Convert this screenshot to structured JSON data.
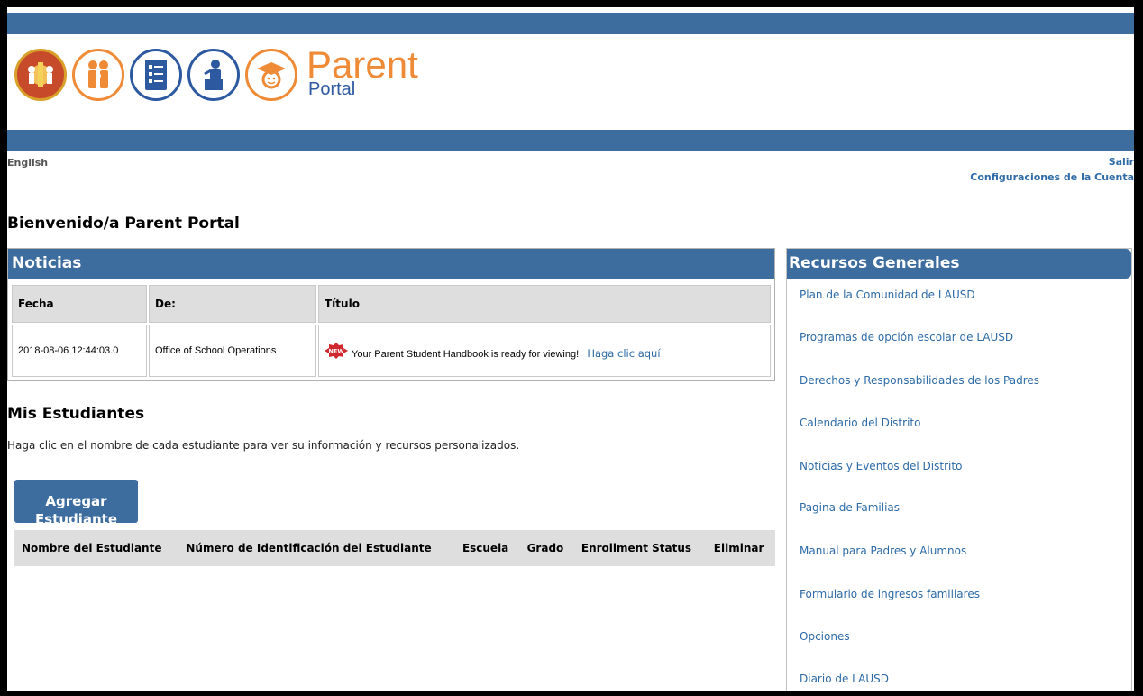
{
  "brand": {
    "parent": "Parent",
    "portal": "Portal",
    "colors": {
      "header_bar": "#3d6c9e",
      "orange": "#ef8a36",
      "blue": "#2c59a0",
      "link": "#2d6aa6"
    }
  },
  "header": {
    "language": "English",
    "logout": "Salir",
    "account_settings": "Configuraciones de la Cuenta"
  },
  "welcome": "Bienvenido/a Parent Portal",
  "news": {
    "title": "Noticias",
    "columns": [
      "Fecha",
      "De:",
      "Título"
    ],
    "rows": [
      {
        "date": "2018-08-06 12:44:03.0",
        "from": "Office of School Operations",
        "badge": "NEW",
        "text": "Your Parent Student Handbook is ready for viewing!",
        "link": "Haga clic aquí"
      }
    ]
  },
  "students": {
    "title": "Mis Estudiantes",
    "description": "Haga clic en el nombre de cada estudiante para ver su información y recursos personalizados.",
    "add_button": "Agregar Estudiante",
    "columns": [
      "Nombre del Estudiante",
      "Número de Identificación del Estudiante",
      "Escuela",
      "Grado",
      "Enrollment Status",
      "Eliminar"
    ]
  },
  "resources": {
    "title": "Recursos Generales",
    "items": [
      "Plan de la Comunidad de LAUSD",
      "Programas de opción escolar de LAUSD",
      "Derechos y Responsabilidades de los Padres",
      "Calendario del Distrito",
      "Noticias y Eventos del Distrito",
      "Pagina de Familias",
      "Manual para Padres y Alumnos",
      "Formulario de ingresos familiares",
      "Opciones",
      "Diario de LAUSD"
    ]
  },
  "icons": [
    "lausd-seal-icon",
    "family-icon",
    "document-icon",
    "teacher-icon",
    "graduate-icon"
  ]
}
